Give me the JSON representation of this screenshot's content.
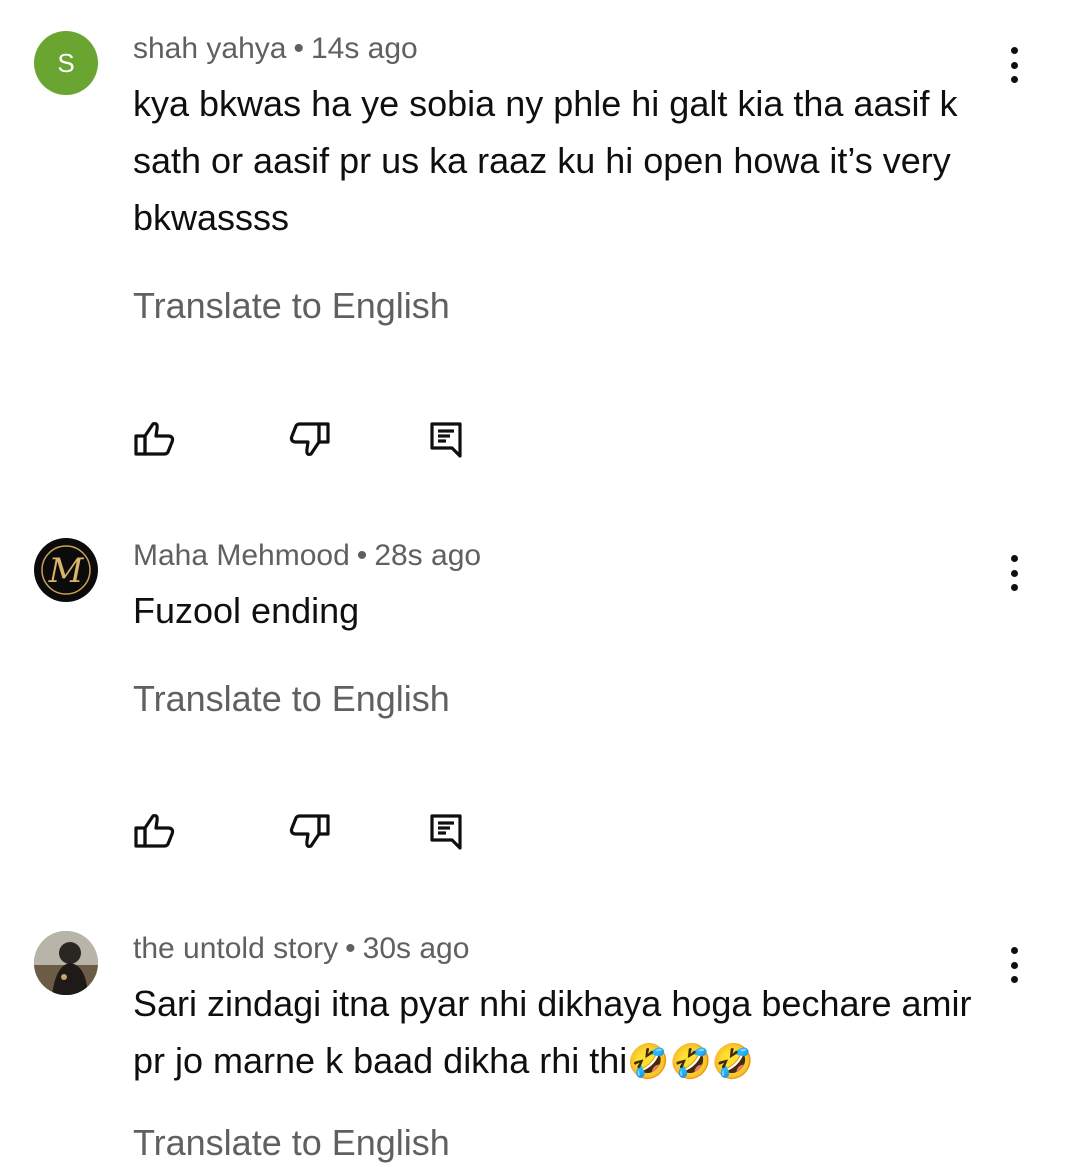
{
  "comments": [
    {
      "author": "shah yahya",
      "separator": "•",
      "time": "14s ago",
      "avatar_letter": "S",
      "text": "kya bkwas ha ye sobia ny phle hi galt kia tha aasif k sath or aasif pr us ka raaz ku hi open howa it’s very bkwassss",
      "translate": "Translate to English"
    },
    {
      "author": "Maha Mehmood",
      "separator": "•",
      "time": "28s ago",
      "avatar_letter": "M",
      "text": "Fuzool ending",
      "translate": "Translate to English"
    },
    {
      "author": "the untold story",
      "separator": "•",
      "time": "30s ago",
      "text": "Sari zindagi itna pyar nhi dikhaya hoga bechare amir pr jo marne k baad dikha rhi thi",
      "emoji": "🤣🤣🤣",
      "translate": "Translate to English"
    }
  ],
  "icons": {
    "like": "thumb-up-icon",
    "dislike": "thumb-down-icon",
    "reply": "reply-comment-icon",
    "more": "more-vertical-icon"
  },
  "colors": {
    "avatar_green": "#6aa532",
    "secondary_text": "#606060",
    "primary_text": "#0f0f0f"
  }
}
